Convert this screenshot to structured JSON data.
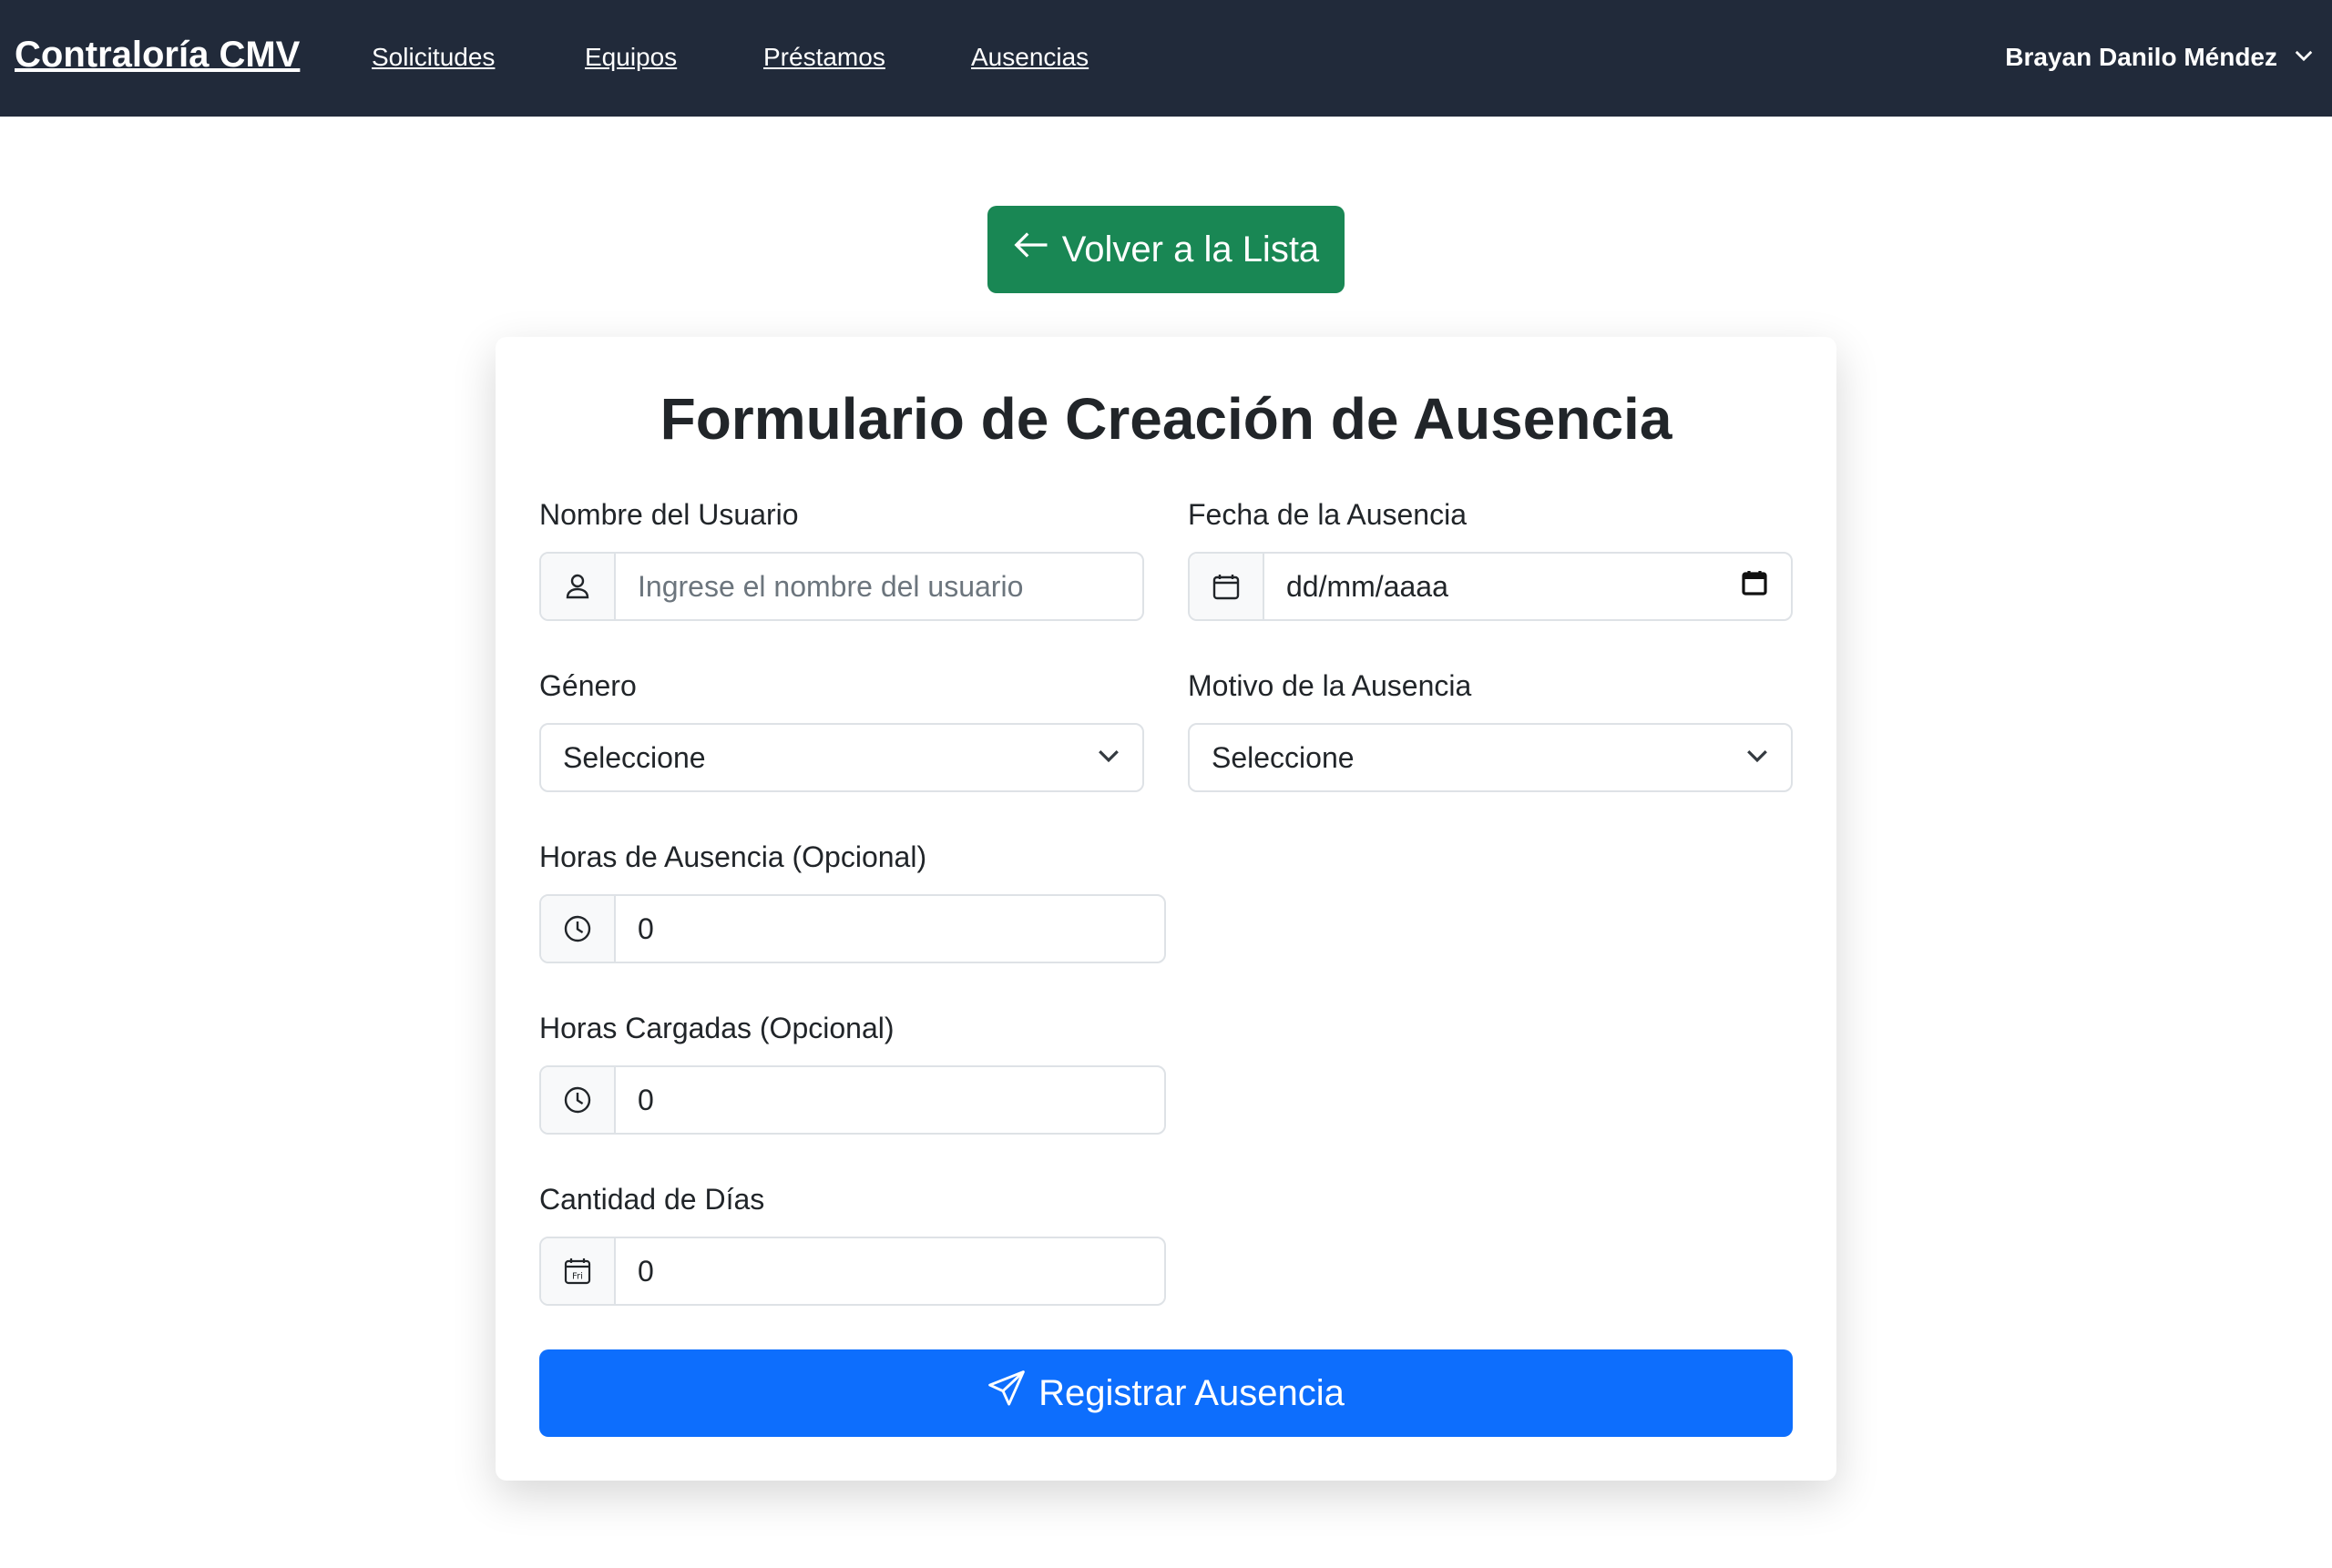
{
  "navbar": {
    "brand": "Contraloría CMV",
    "links": [
      "Solicitudes",
      "Equipos",
      "Préstamos",
      "Ausencias"
    ],
    "user": "Brayan Danilo Méndez"
  },
  "back_button": {
    "label": "Volver a la Lista",
    "icon": "arrow-left-icon",
    "color": "#198754"
  },
  "form": {
    "title": "Formulario de Creación de Ausencia",
    "usuario": {
      "label": "Nombre del Usuario",
      "placeholder": "Ingrese el nombre del usuario",
      "icon": "person-icon"
    },
    "fecha": {
      "label": "Fecha de la Ausencia",
      "value": "dd/mm/aaaa",
      "icon": "calendar-icon"
    },
    "genero": {
      "label": "Género",
      "selected": "Seleccione"
    },
    "motivo": {
      "label": "Motivo de la Ausencia",
      "selected": "Seleccione"
    },
    "horas_ausencia": {
      "label": "Horas de Ausencia (Opcional)",
      "value": "0",
      "icon": "clock-icon"
    },
    "horas_cargadas": {
      "label": "Horas Cargadas (Opcional)",
      "value": "0",
      "icon": "clock-icon"
    },
    "cantidad_dias": {
      "label": "Cantidad de Días",
      "value": "0",
      "icon": "calendar-day-icon",
      "icon_text": "Fri"
    },
    "submit": {
      "label": "Registrar Ausencia",
      "icon": "send-icon",
      "color": "#0d6efd"
    }
  }
}
